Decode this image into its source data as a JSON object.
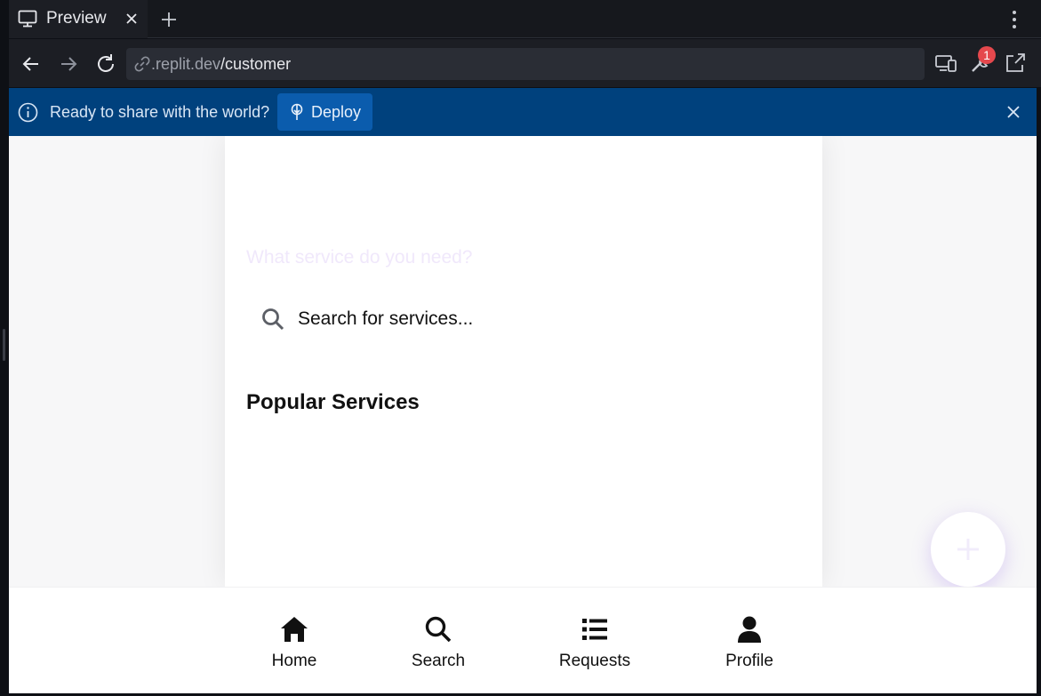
{
  "browser": {
    "tab_title": "Preview",
    "url_host": ".replit.dev",
    "url_path": "/customer",
    "notification_count": "1"
  },
  "banner": {
    "message": "Ready to share with the world?",
    "deploy_label": "Deploy"
  },
  "main": {
    "prompt": "What service do you need?",
    "search_placeholder": "Search for services...",
    "section_title": "Popular Services"
  },
  "bottom_nav": {
    "items": [
      {
        "label": "Home",
        "icon": "home-icon"
      },
      {
        "label": "Search",
        "icon": "search-icon"
      },
      {
        "label": "Requests",
        "icon": "list-icon"
      },
      {
        "label": "Profile",
        "icon": "user-icon"
      }
    ]
  },
  "colors": {
    "banner_bg": "#00417d",
    "deploy_bg": "#0b5cad",
    "badge": "#e5484d",
    "prompt_text": "#f0e8fb"
  }
}
